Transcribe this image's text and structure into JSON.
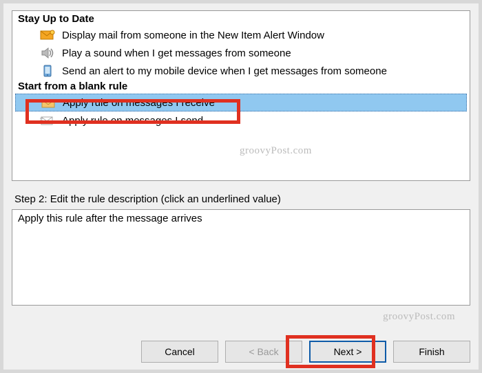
{
  "section1_title": "Stay Up to Date",
  "section1_items": [
    "Display mail from someone in the New Item Alert Window",
    "Play a sound when I get messages from someone",
    "Send an alert to my mobile device when I get messages from someone"
  ],
  "section2_title": "Start from a blank rule",
  "section2_items": [
    "Apply rule on messages I receive",
    "Apply rule on messages I send"
  ],
  "watermark": "groovyPost.com",
  "step2_label": "Step 2: Edit the rule description (click an underlined value)",
  "desc_text": "Apply this rule after the message arrives",
  "buttons": {
    "cancel": "Cancel",
    "back": "< Back",
    "next": "Next >",
    "finish": "Finish"
  }
}
